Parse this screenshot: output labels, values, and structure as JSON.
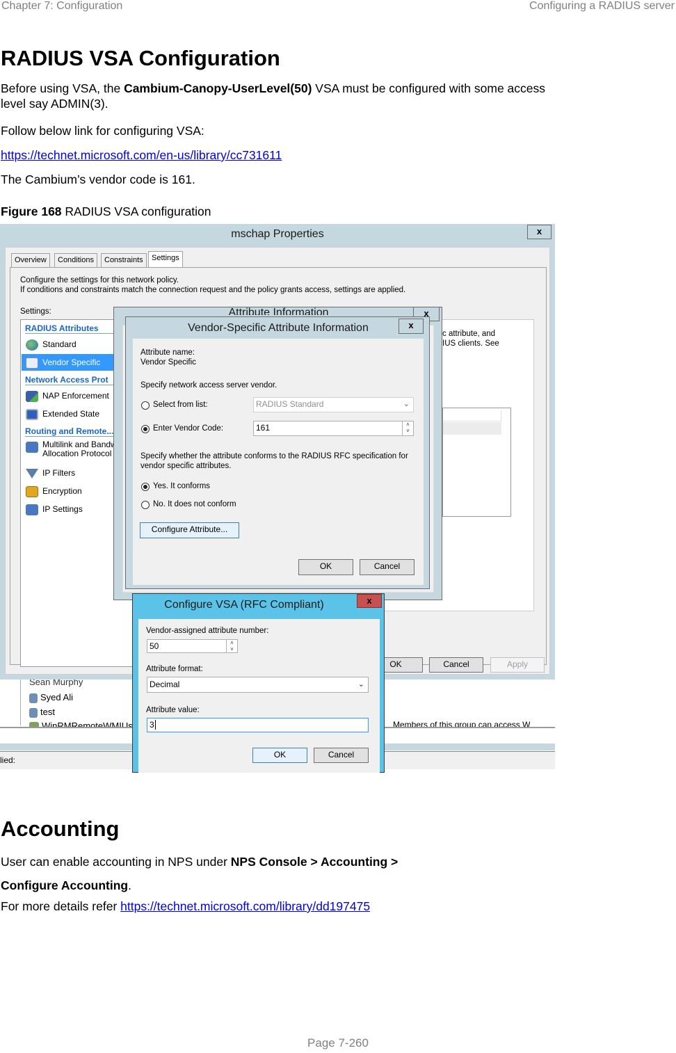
{
  "header": {
    "chapter": "Chapter 7:  Configuration",
    "section": "Configuring a RADIUS server"
  },
  "section1": {
    "title": "RADIUS VSA Configuration",
    "para1_pre": "Before using VSA, the ",
    "para1_bold": "Cambium-Canopy-UserLevel(50)",
    "para1_post": " VSA must be configured with some access",
    "para1_line2": "level say ADMIN(3).",
    "para2": "Follow below link for configuring VSA:",
    "link1": "https://technet.microsoft.com/en-us/library/cc731611",
    "para3": "The Cambium’s vendor code is 161.",
    "figure_label": "Figure 168",
    "figure_caption": " RADIUS VSA configuration"
  },
  "screenshot": {
    "main_window": {
      "title": "mschap Properties",
      "close": "x",
      "tabs": [
        "Overview",
        "Conditions",
        "Constraints",
        "Settings"
      ],
      "active_tab": "Settings",
      "intro_line1": "Configure the settings for this network policy.",
      "intro_line2": "If conditions and constraints match the connection request and the policy grants access, settings are applied.",
      "settings_label": "Settings:",
      "right_text_line1": "c attribute, and",
      "right_text_line2": "IUS clients. See",
      "groups": [
        {
          "label": "RADIUS Attributes",
          "items": [
            {
              "label": "Standard",
              "icon": "globe-key-icon"
            },
            {
              "label": "Vendor Specific",
              "icon": "checklist-icon",
              "selected": true
            }
          ]
        },
        {
          "label": "Network Access Prot",
          "items": [
            {
              "label": "NAP Enforcement",
              "icon": "computer-shield-icon"
            },
            {
              "label": "Extended State",
              "icon": "monitor-check-icon"
            }
          ]
        },
        {
          "label": "Routing and Remote...",
          "items": [
            {
              "label": "Multilink and Bandw",
              "label2": "Allocation Protocol",
              "icon": "network-icon"
            },
            {
              "label": "IP Filters",
              "icon": "funnel-icon"
            },
            {
              "label": "Encryption",
              "icon": "padlock-icon"
            },
            {
              "label": "IP Settings",
              "icon": "network-icon"
            }
          ]
        }
      ],
      "buttons": {
        "ok": "OK",
        "cancel": "Cancel",
        "apply": "Apply"
      }
    },
    "attr_info_window": {
      "title": "Attribute Information",
      "close": "x"
    },
    "vsa_window": {
      "title": "Vendor-Specific Attribute Information",
      "close": "x",
      "attr_name_label": "Attribute name:",
      "attr_name_value": "Vendor Specific",
      "vendor_prompt": "Specify network access server vendor.",
      "radio_select_list": "Select from list:",
      "select_list_value": "RADIUS Standard",
      "radio_enter_code": "Enter Vendor Code:",
      "vendor_code": "161",
      "conform_prompt_line1": "Specify whether the attribute conforms to the RADIUS RFC specification for",
      "conform_prompt_line2": "vendor specific attributes.",
      "radio_yes": "Yes. It conforms",
      "radio_no": "No. It does not conform",
      "configure_button": "Configure Attribute...",
      "ok": "OK",
      "cancel": "Cancel"
    },
    "configure_vsa_window": {
      "title": "Configure VSA (RFC Compliant)",
      "close": "x",
      "attr_number_label": "Vendor-assigned attribute number:",
      "attr_number": "50",
      "format_label": "Attribute format:",
      "format_value": "Decimal",
      "value_label": "Attribute value:",
      "value": "3",
      "ok": "OK",
      "cancel": "Cancel"
    },
    "background": {
      "users": [
        "Sean Murphy",
        "Syed Ali",
        "test",
        "WinRMRemoteWMIUs"
      ],
      "description": "Members of this group can access W",
      "status": "lied:"
    }
  },
  "section2": {
    "title": "Accounting",
    "para1_pre": "User can enable accounting in NPS under ",
    "para1_bold": "NPS Console > Accounting >",
    "para1_bold2": "Configure Accounting",
    "para1_post": ".",
    "para2_pre": "For more details refer ",
    "link2": "https://technet.microsoft.com/library/dd197475"
  },
  "footer": {
    "page": "Page 7-260"
  }
}
